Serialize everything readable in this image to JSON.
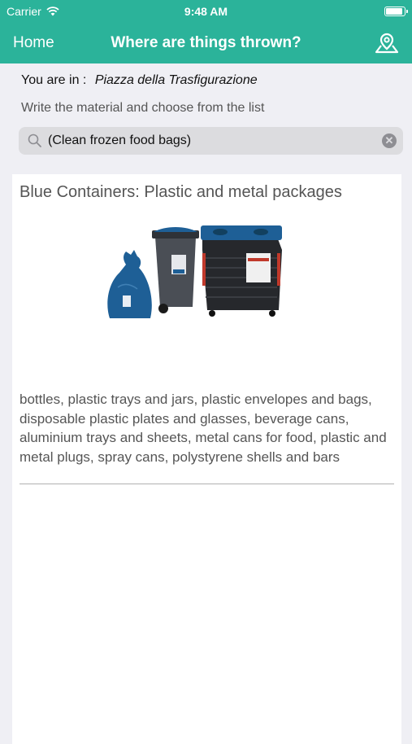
{
  "status_bar": {
    "carrier": "Carrier",
    "time": "9:48 AM",
    "battery_level": 0.95
  },
  "nav": {
    "home_label": "Home",
    "title": "Where are things thrown?",
    "map_icon": "map-pin-icon"
  },
  "location": {
    "prefix": "You  are in :",
    "place": "Piazza della Trasfigurazione"
  },
  "hint": "Write the material and choose from the list",
  "search": {
    "value": "(Clean frozen food bags)",
    "icon": "search-icon",
    "clear_icon": "clear-icon"
  },
  "result": {
    "title": "Blue Containers: Plastic and metal packages",
    "image": "blue-containers-illustration",
    "description": "bottles, plastic trays and jars, plastic envelopes and bags, disposable plastic plates and glasses, beverage cans, aluminium trays and sheets, metal cans for food, plastic and metal plugs, spray cans, polystyrene shells and bars"
  },
  "colors": {
    "accent": "#2bb39a",
    "background": "#efeff4",
    "bin_blue": "#1e5f96"
  }
}
